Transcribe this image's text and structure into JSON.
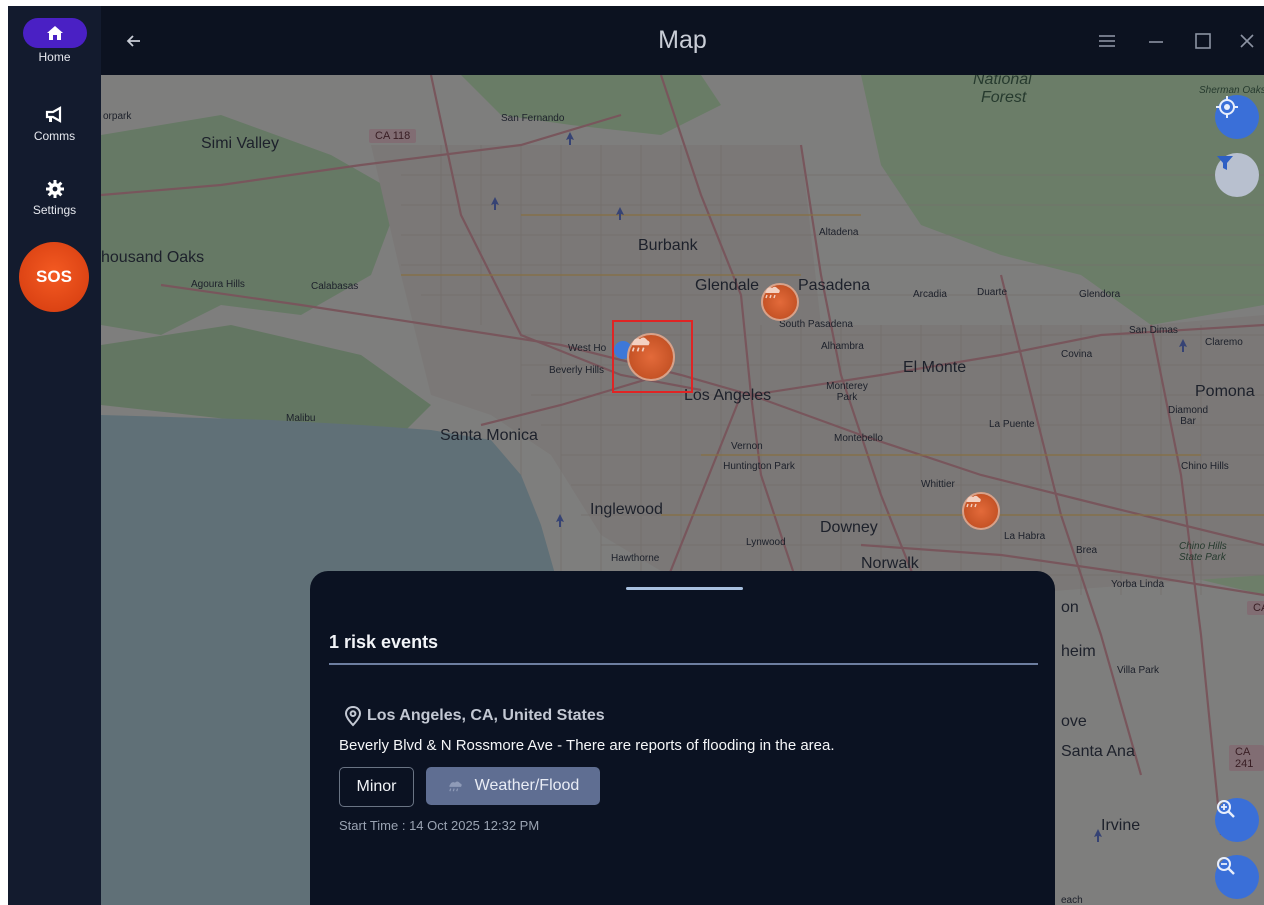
{
  "window": {
    "title": "Map",
    "back_icon": "arrow-left-icon",
    "controls": [
      "menu-icon",
      "minimize-icon",
      "maximize-icon",
      "close-icon"
    ]
  },
  "sidebar": {
    "items": [
      {
        "label": "Home",
        "icon": "home-icon",
        "active": true
      },
      {
        "label": "Comms",
        "icon": "megaphone-icon",
        "active": false
      },
      {
        "label": "Settings",
        "icon": "gear-icon",
        "active": false
      }
    ],
    "sos_label": "SOS"
  },
  "map": {
    "labels": {
      "simi_valley": "Simi Valley",
      "thousand_oaks": "housand Oaks",
      "agoura_hills": "Agoura Hills",
      "calabasas": "Calabasas",
      "malibu": "Malibu",
      "orpark": "orpark",
      "ca118": "CA 118",
      "san_fernando": "San Fernando",
      "national": "National",
      "forest": "Forest",
      "burbank": "Burbank",
      "altadena": "Altadena",
      "glendale": "Glendale",
      "pasadena": "Pasadena",
      "arcadia": "Arcadia",
      "duarte": "Duarte",
      "glendora": "Glendora",
      "south_pasadena": "South Pasadena",
      "alhambra": "Alhambra",
      "san_dimas": "San Dimas",
      "claremont": "Claremo",
      "covina": "Covina",
      "west_hollywood": "West Ho",
      "beverly_hills": "Beverly Hills",
      "el_monte": "El Monte",
      "los_angeles": "Los Angeles",
      "monterey_park": "Monterey Park",
      "pomona": "Pomona",
      "diamond_bar": "Diamond Bar",
      "santa_monica": "Santa Monica",
      "la_puente": "La Puente",
      "montebello": "Montebello",
      "vernon": "Vernon",
      "huntington_park": "Huntington Park",
      "chino_hills": "Chino Hills",
      "whittier": "Whittier",
      "inglewood": "Inglewood",
      "downey": "Downey",
      "la_habra": "La Habra",
      "brea": "Brea",
      "chino_hills_park": "Chino Hills State Park",
      "lynwood": "Lynwood",
      "hawthorne": "Hawthorne",
      "norwalk": "Norwalk",
      "yorba_linda": "Yorba Linda",
      "ca_right": "CA",
      "on": "on",
      "heim": "heim",
      "villa_park": "Villa Park",
      "ove": "ove",
      "santa_ana": "Santa Ana",
      "ca241": "CA 241",
      "irvine": "Irvine",
      "each": "each",
      "sherman_oaks": "Sherman Oaks"
    },
    "markers": [
      {
        "name": "risk-marker-glendale",
        "icon": "flood-icon"
      },
      {
        "name": "risk-marker-beverly-hills",
        "icon": "flood-icon",
        "selected": true
      },
      {
        "name": "risk-marker-whittier",
        "icon": "flood-icon"
      }
    ],
    "buttons": {
      "locate_icon": "locate-icon",
      "filter_icon": "filter-icon",
      "zoom_in_icon": "zoom-in-icon",
      "zoom_out_icon": "zoom-out-icon"
    }
  },
  "sheet": {
    "title": "1 risk events",
    "event": {
      "location": "Los Angeles, CA, United States",
      "description": "Beverly Blvd & N Rossmore Ave - There are reports of flooding in the area.",
      "severity": "Minor",
      "category": "Weather/Flood",
      "start_time": "Start Time : 14 Oct 2025 12:32 PM"
    }
  },
  "colors": {
    "sidebar_bg": "#131b2e",
    "active_pill": "#4a20c4",
    "sos": "#e84a16",
    "sheet_bg": "#0b1222",
    "chip_category": "#5f6e92",
    "fab_blue": "#3a6fd8",
    "marker": "#c9532a"
  }
}
